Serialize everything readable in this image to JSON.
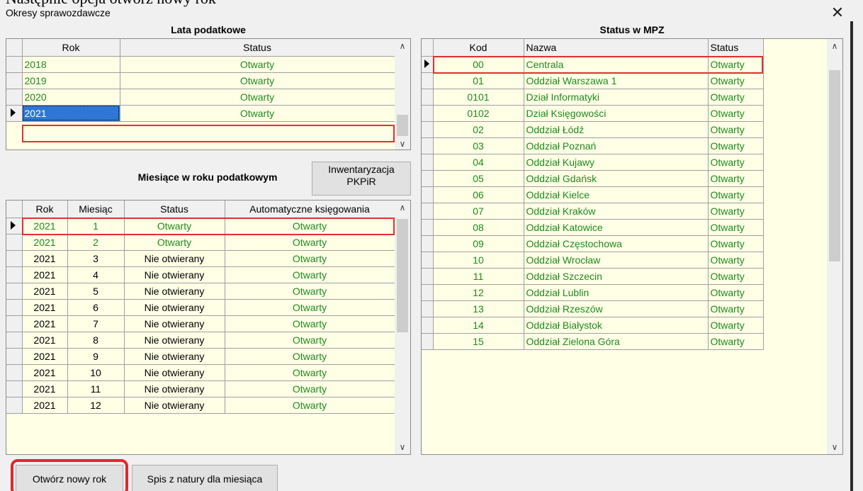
{
  "doc": {
    "caption": "Następnie opcja otwórz nowy rok"
  },
  "window": {
    "title": "Okresy sprawozdawcze",
    "close_glyph": "✕"
  },
  "lata": {
    "title": "Lata podatkowe",
    "headers": [
      "Rok",
      "Status"
    ],
    "rows": [
      {
        "rok": "2018",
        "status": "Otwarty"
      },
      {
        "rok": "2019",
        "status": "Otwarty"
      },
      {
        "rok": "2020",
        "status": "Otwarty"
      },
      {
        "rok": "2021",
        "status": "Otwarty"
      }
    ]
  },
  "miesiace": {
    "title": "Miesiące w roku podatkowym",
    "headers": [
      "Rok",
      "Miesiąc",
      "Status",
      "Automatyczne księgowania"
    ],
    "rows": [
      {
        "rok": "2021",
        "miesiac": "1",
        "status": "Otwarty",
        "auto": "Otwarty"
      },
      {
        "rok": "2021",
        "miesiac": "2",
        "status": "Otwarty",
        "auto": "Otwarty"
      },
      {
        "rok": "2021",
        "miesiac": "3",
        "status": "Nie otwierany",
        "auto": "Otwarty"
      },
      {
        "rok": "2021",
        "miesiac": "4",
        "status": "Nie otwierany",
        "auto": "Otwarty"
      },
      {
        "rok": "2021",
        "miesiac": "5",
        "status": "Nie otwierany",
        "auto": "Otwarty"
      },
      {
        "rok": "2021",
        "miesiac": "6",
        "status": "Nie otwierany",
        "auto": "Otwarty"
      },
      {
        "rok": "2021",
        "miesiac": "7",
        "status": "Nie otwierany",
        "auto": "Otwarty"
      },
      {
        "rok": "2021",
        "miesiac": "8",
        "status": "Nie otwierany",
        "auto": "Otwarty"
      },
      {
        "rok": "2021",
        "miesiac": "9",
        "status": "Nie otwierany",
        "auto": "Otwarty"
      },
      {
        "rok": "2021",
        "miesiac": "10",
        "status": "Nie otwierany",
        "auto": "Otwarty"
      },
      {
        "rok": "2021",
        "miesiac": "11",
        "status": "Nie otwierany",
        "auto": "Otwarty"
      },
      {
        "rok": "2021",
        "miesiac": "12",
        "status": "Nie otwierany",
        "auto": "Otwarty"
      }
    ]
  },
  "mpz": {
    "title": "Status w MPZ",
    "headers": [
      "Kod",
      "Nazwa",
      "Status"
    ],
    "rows": [
      {
        "kod": "00",
        "nazwa": "Centrala",
        "status": "Otwarty"
      },
      {
        "kod": "01",
        "nazwa": "Oddział Warszawa 1",
        "status": "Otwarty"
      },
      {
        "kod": "0101",
        "nazwa": "Dział Informatyki",
        "status": "Otwarty"
      },
      {
        "kod": "0102",
        "nazwa": "Dział Księgowości",
        "status": "Otwarty"
      },
      {
        "kod": "02",
        "nazwa": "Oddział Łódź",
        "status": "Otwarty"
      },
      {
        "kod": "03",
        "nazwa": "Oddział Poznań",
        "status": "Otwarty"
      },
      {
        "kod": "04",
        "nazwa": "Oddział Kujawy",
        "status": "Otwarty"
      },
      {
        "kod": "05",
        "nazwa": "Oddział Gdańsk",
        "status": "Otwarty"
      },
      {
        "kod": "06",
        "nazwa": "Oddział Kielce",
        "status": "Otwarty"
      },
      {
        "kod": "07",
        "nazwa": "Oddział Kraków",
        "status": "Otwarty"
      },
      {
        "kod": "08",
        "nazwa": "Oddział Katowice",
        "status": "Otwarty"
      },
      {
        "kod": "09",
        "nazwa": "Oddział Częstochowa",
        "status": "Otwarty"
      },
      {
        "kod": "10",
        "nazwa": "Oddział Wrocław",
        "status": "Otwarty"
      },
      {
        "kod": "11",
        "nazwa": "Oddział Szczecin",
        "status": "Otwarty"
      },
      {
        "kod": "12",
        "nazwa": "Oddział Lublin",
        "status": "Otwarty"
      },
      {
        "kod": "13",
        "nazwa": "Oddział Rzeszów",
        "status": "Otwarty"
      },
      {
        "kod": "14",
        "nazwa": "Oddział Białystok",
        "status": "Otwarty"
      },
      {
        "kod": "15",
        "nazwa": "Oddział Zielona Góra",
        "status": "Otwarty"
      }
    ]
  },
  "buttons": {
    "inwentaryzacja_line1": "Inwentaryzacja",
    "inwentaryzacja_line2": "PKPiR",
    "otworz_nowy_rok": "Otwórz nowy rok",
    "spis_z_natury": "Spis z natury dla miesiąca"
  },
  "scroll_glyphs": {
    "up": "∧",
    "down": "∨"
  },
  "colors": {
    "grid_bg": "#ffffe6",
    "status_green": "#1f8a1f",
    "selection_blue": "#2f77d6",
    "highlight_red": "#e3262b"
  }
}
